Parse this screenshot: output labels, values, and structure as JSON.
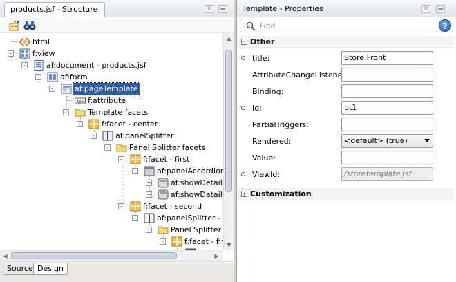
{
  "structure_panel": {
    "tab_title": "products.jsf - Structure",
    "tree": [
      {
        "label": "html",
        "icon": "html-tag-icon",
        "toggle": ""
      },
      {
        "label": "f:view",
        "icon": "component-grid-icon",
        "toggle": "-"
      },
      {
        "label": "af:document - products.jsf",
        "icon": "document-icon",
        "toggle": "-"
      },
      {
        "label": "af:form",
        "icon": "component-grid-icon",
        "toggle": "-"
      },
      {
        "label": "af:pageTemplate",
        "icon": "page-template-icon",
        "toggle": "-",
        "selected": true
      },
      {
        "label": "f:attribute",
        "icon": "attribute-icon",
        "toggle": ""
      },
      {
        "label": "Template facets",
        "icon": "folder-icon",
        "toggle": "-"
      },
      {
        "label": "f:facet - center",
        "icon": "facet-icon",
        "toggle": "-"
      },
      {
        "label": "af:panelSplitter",
        "icon": "splitter-icon",
        "toggle": "-"
      },
      {
        "label": "Panel Splitter facets",
        "icon": "folder-icon",
        "toggle": "-"
      },
      {
        "label": "f:facet - first",
        "icon": "facet-icon",
        "toggle": "-"
      },
      {
        "label": "af:panelAccordion -",
        "icon": "accordion-icon",
        "toggle": "-"
      },
      {
        "label": "af:showDetailIt",
        "icon": "show-detail-icon",
        "toggle": "+"
      },
      {
        "label": "af:showDetailIt",
        "icon": "show-detail-icon",
        "toggle": "+"
      },
      {
        "label": "f:facet - second",
        "icon": "facet-icon",
        "toggle": "-"
      },
      {
        "label": "af:panelSplitter - ve",
        "icon": "splitter-icon",
        "toggle": "-"
      },
      {
        "label": "Panel Splitter fa",
        "icon": "folder-icon",
        "toggle": "-"
      },
      {
        "label": "f:facet - firs",
        "icon": "facet-icon",
        "toggle": "-"
      },
      {
        "label": "f",
        "icon": "facet-icon",
        "toggle": ""
      }
    ],
    "bottom_tabs": [
      {
        "label": "Source",
        "active": false
      },
      {
        "label": "Design",
        "active": true
      }
    ]
  },
  "properties_panel": {
    "title": "Template - Properties",
    "search_placeholder": "Find",
    "help_label": "?",
    "sections": [
      {
        "label": "Other",
        "toggle": "-"
      },
      {
        "label": "Customization",
        "toggle": "+"
      }
    ],
    "properties": [
      {
        "label": "title:",
        "value": "Store Front",
        "required": true,
        "kind": "text"
      },
      {
        "label": "AttributeChangeListener:",
        "value": "",
        "required": false,
        "kind": "text"
      },
      {
        "label": "Binding:",
        "value": "",
        "required": false,
        "kind": "text"
      },
      {
        "label": "Id:",
        "value": "pt1",
        "required": true,
        "kind": "text"
      },
      {
        "label": "PartialTriggers:",
        "value": "",
        "required": false,
        "kind": "text"
      },
      {
        "label": "Rendered:",
        "value": "<default> (true)",
        "required": false,
        "kind": "select"
      },
      {
        "label": "Value:",
        "value": "",
        "required": false,
        "kind": "text"
      },
      {
        "label": "ViewId:",
        "value": "/storetemplate.jsf",
        "required": true,
        "kind": "readonly"
      }
    ]
  }
}
